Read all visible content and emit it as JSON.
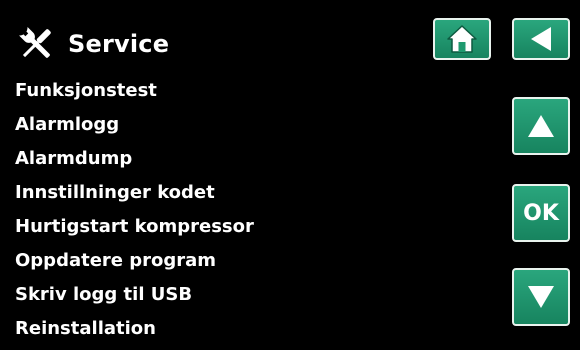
{
  "header": {
    "title": "Service",
    "icon": "tools-icon"
  },
  "menu": {
    "items": [
      {
        "label": "Funksjonstest"
      },
      {
        "label": "Alarmlogg"
      },
      {
        "label": "Alarmdump"
      },
      {
        "label": "Innstillninger kodet"
      },
      {
        "label": "Hurtigstart kompressor"
      },
      {
        "label": "Oppdatere program"
      },
      {
        "label": "Skriv logg til USB"
      },
      {
        "label": "Reinstallation"
      }
    ]
  },
  "buttons": {
    "home_icon": "home-icon",
    "back_icon": "back-arrow-icon",
    "up_icon": "arrow-up-icon",
    "ok_label": "OK",
    "down_icon": "arrow-down-icon"
  },
  "colors": {
    "background": "#000000",
    "text": "#ffffff",
    "button_green": "#1f9a6f",
    "button_border": "#e9f3ee"
  }
}
